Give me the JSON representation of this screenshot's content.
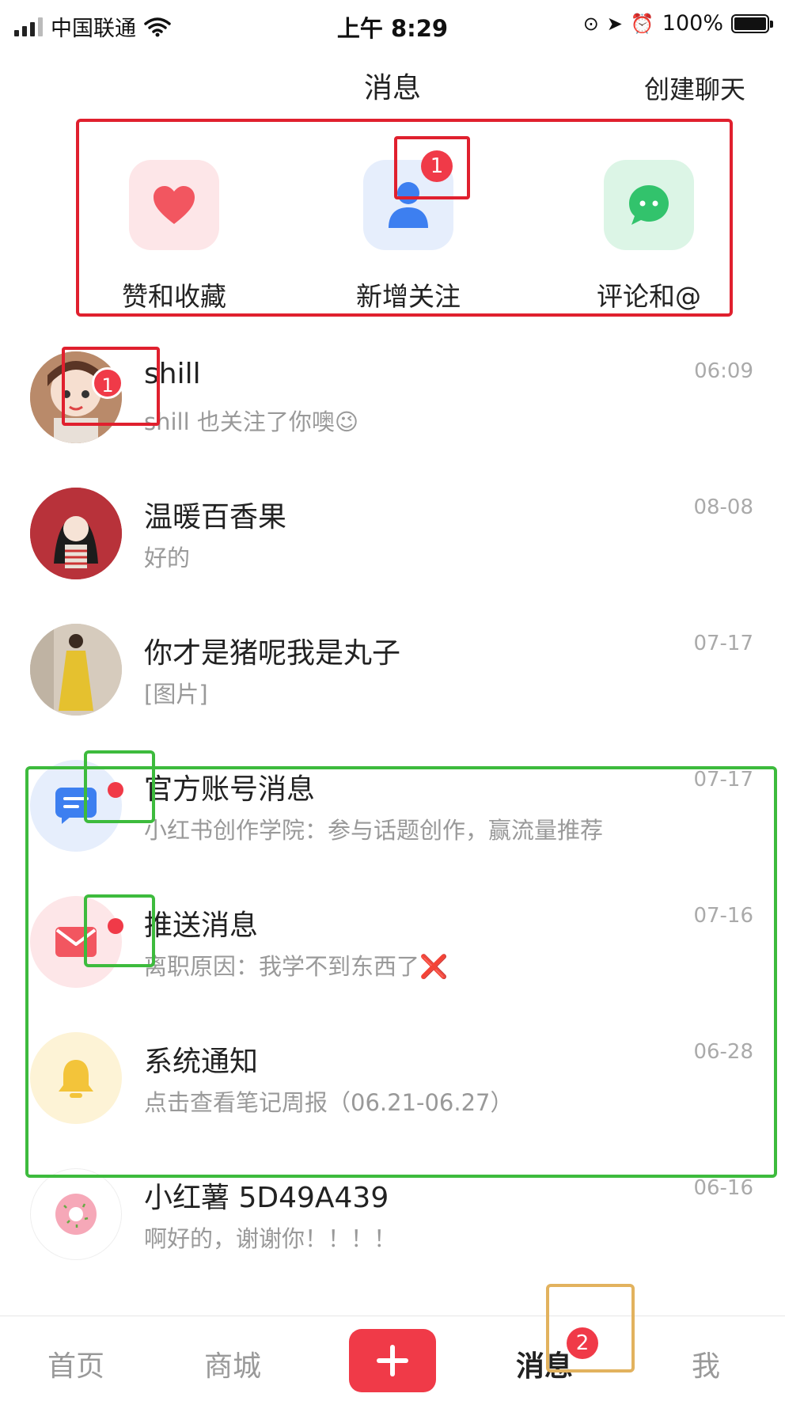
{
  "status_bar": {
    "carrier": "中国联通",
    "time": "上午 8:29",
    "battery": "100%"
  },
  "header": {
    "title": "消息",
    "create_chat": "创建聊天"
  },
  "shortcuts": [
    {
      "label": "赞和收藏",
      "icon": "heart-icon",
      "color": "#f25660"
    },
    {
      "label": "新增关注",
      "icon": "person-icon",
      "color": "#3d7ff0",
      "badge": "1"
    },
    {
      "label": "评论和@",
      "icon": "chat-bubble-icon",
      "color": "#32c36c"
    }
  ],
  "conversations": [
    {
      "name": "shill",
      "preview": "shill 也关注了你噢",
      "preview_emoji": "😉",
      "time": "06:09",
      "badge": "1"
    },
    {
      "name": "温暖百香果",
      "preview": "好的",
      "time": "08-08"
    },
    {
      "name": "你才是猪呢我是丸子",
      "preview": "[图片]",
      "time": "07-17"
    },
    {
      "name": "官方账号消息",
      "preview": "小红书创作学院：参与话题创作，赢流量推荐",
      "time": "07-17",
      "unread_dot": true
    },
    {
      "name": "推送消息",
      "preview": "离职原因：我学不到东西了",
      "preview_emoji": "❌",
      "time": "07-16",
      "unread_dot": true
    },
    {
      "name": "系统通知",
      "preview": "点击查看笔记周报（06.21-06.27）",
      "time": "06-28"
    },
    {
      "name": "小红薯 5D49A439",
      "preview": "啊好的，谢谢你！！！！",
      "time": "06-16"
    }
  ],
  "tabbar": {
    "home": "首页",
    "mall": "商城",
    "post": "+",
    "messages": "消息",
    "messages_badge": "2",
    "me": "我"
  },
  "colors": {
    "brand_red": "#f03a48",
    "annotation_red": "#e0202e",
    "annotation_green": "#3dbb3d",
    "annotation_orange": "#e2b25e"
  }
}
